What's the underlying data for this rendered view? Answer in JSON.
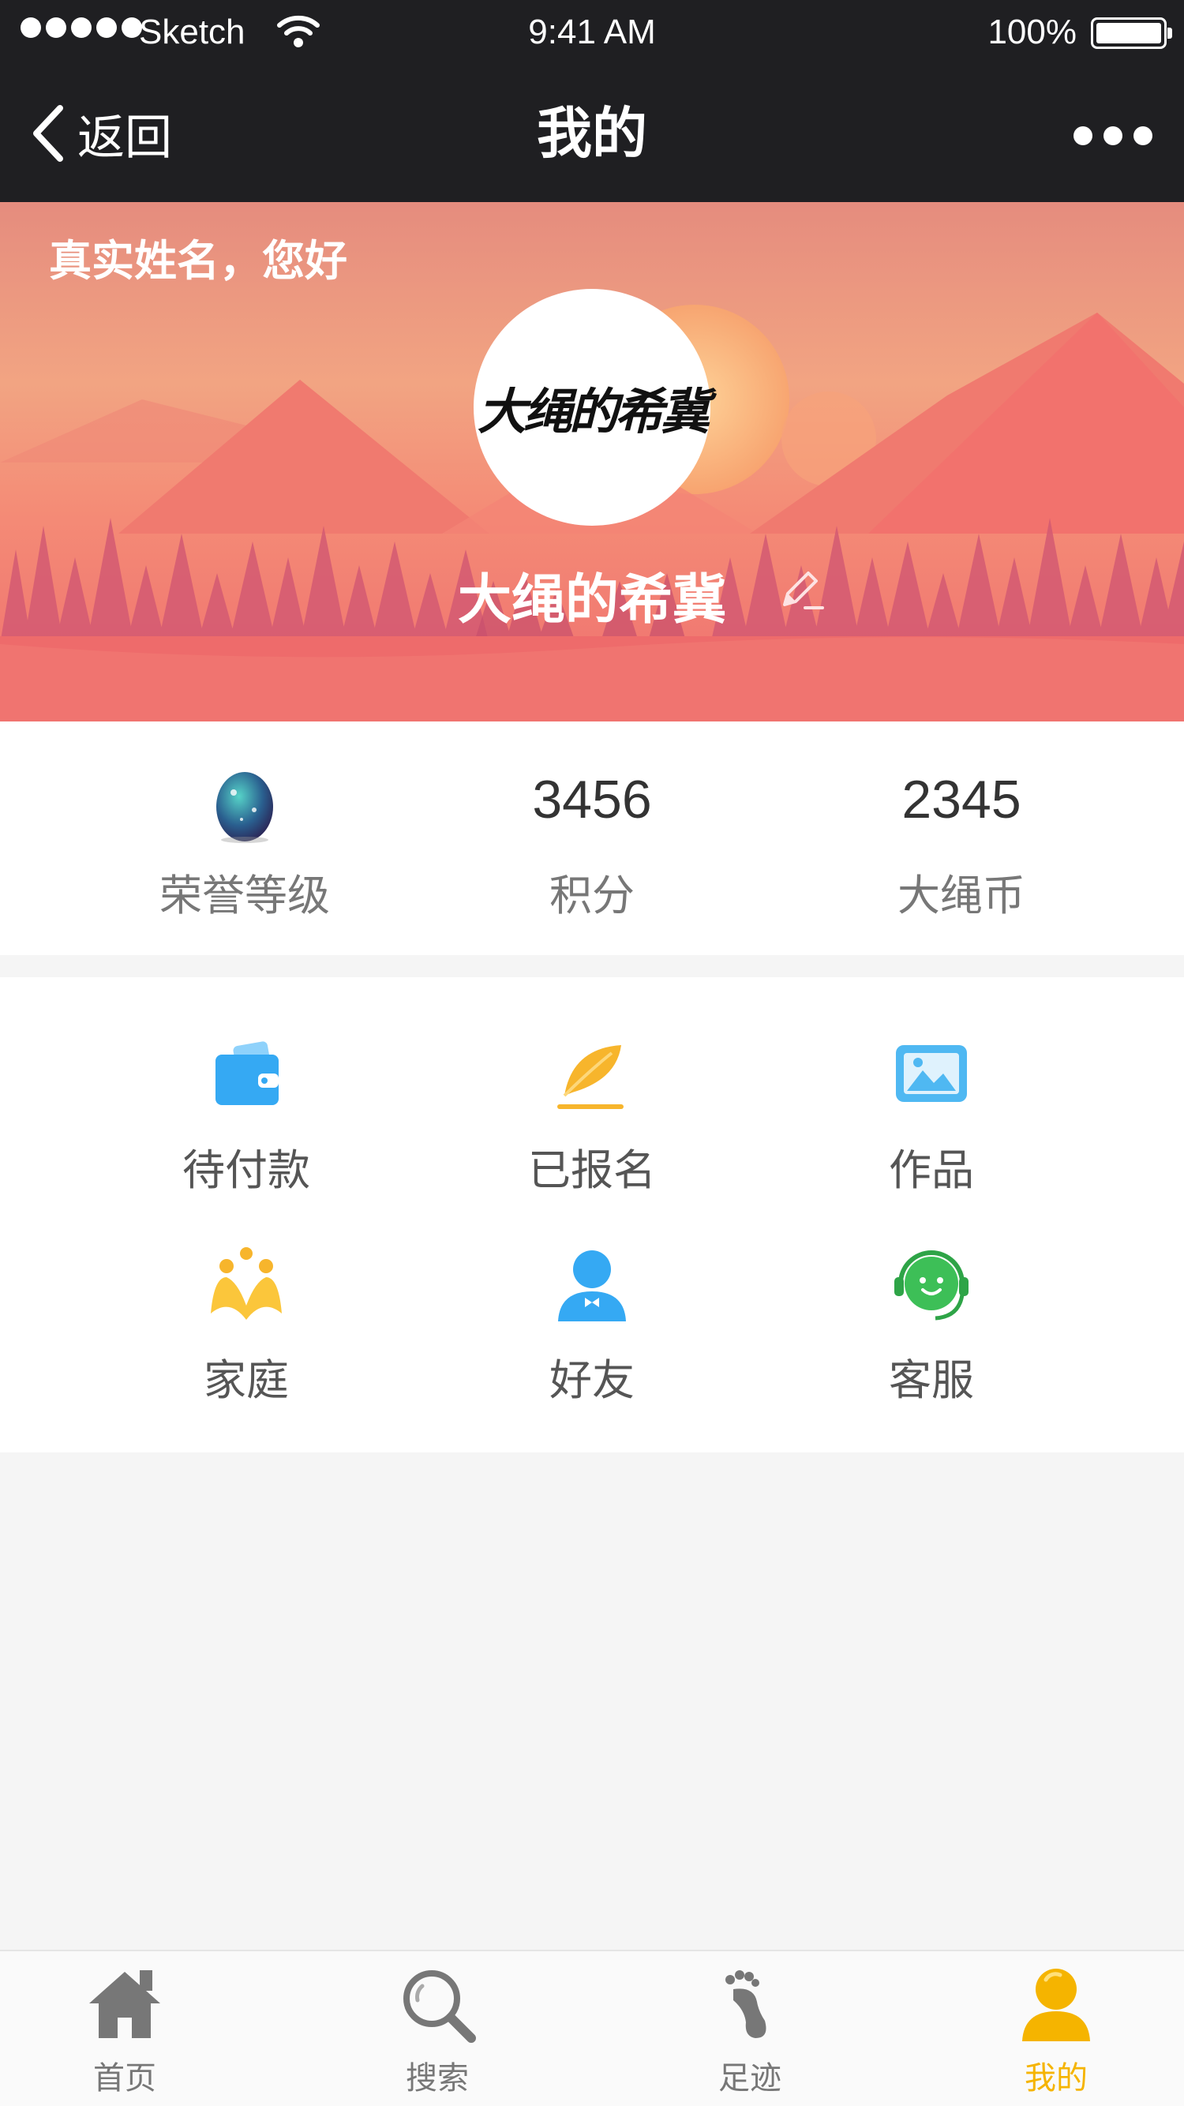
{
  "status_bar": {
    "carrier": "Sketch",
    "time": "9:41 AM",
    "battery": "100%"
  },
  "nav": {
    "back_label": "返回",
    "title": "我的"
  },
  "profile": {
    "greeting": "真实姓名，您好",
    "avatar_logo": "大绳的希冀",
    "nickname": "大绳的希冀"
  },
  "stats": [
    {
      "label": "荣誉等级",
      "value": ""
    },
    {
      "label": "积分",
      "value": "3456"
    },
    {
      "label": "大绳币",
      "value": "2345"
    }
  ],
  "menu": [
    {
      "label": "待付款",
      "icon": "wallet-icon",
      "color": "#35a9f3"
    },
    {
      "label": "已报名",
      "icon": "feather-icon",
      "color": "#f7b52c"
    },
    {
      "label": "作品",
      "icon": "picture-icon",
      "color": "#4fb8f2"
    },
    {
      "label": "家庭",
      "icon": "family-icon",
      "color": "#f7b52c"
    },
    {
      "label": "好友",
      "icon": "friend-icon",
      "color": "#35a9f3"
    },
    {
      "label": "客服",
      "icon": "headset-icon",
      "color": "#3dbf57"
    }
  ],
  "tabs": [
    {
      "label": "首页",
      "icon": "home-icon",
      "active": false
    },
    {
      "label": "搜索",
      "icon": "search-icon",
      "active": false
    },
    {
      "label": "足迹",
      "icon": "footprint-icon",
      "active": false
    },
    {
      "label": "我的",
      "icon": "user-icon",
      "active": true
    }
  ],
  "colors": {
    "accent": "#f5b400",
    "header_bg": "#1f1f22",
    "banner_red": "#ef6e6e"
  }
}
